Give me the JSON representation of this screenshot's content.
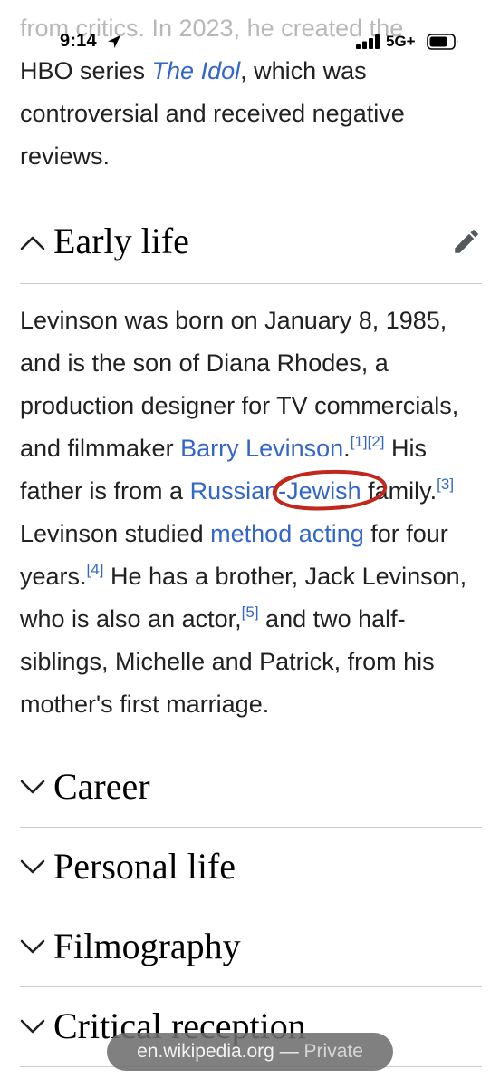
{
  "status_bar": {
    "time": "9:14",
    "network": "5G+"
  },
  "article": {
    "intro": {
      "line1": "from critics. In 2023, he created the",
      "line2_before": "HBO series ",
      "line2_link": "The Idol",
      "line2_after": ", which was",
      "line3": "controversial and received negative",
      "line4": "reviews."
    },
    "early_life": {
      "heading": "Early life",
      "p1": "Levinson was born on January 8, 1985, and is the son of Diana Rhodes, a production designer for TV commercials, and filmmaker ",
      "link_barry": "Barry Levinson",
      "p2": ".",
      "ref1": "[1]",
      "ref2": "[2]",
      "p3": " His father is from a ",
      "link_russian_jewish": "Russian-Jewish",
      "p4": " family.",
      "ref3": "[3]",
      "p5": " Levinson studied ",
      "link_method_acting": "method acting",
      "p6": " for four years.",
      "ref4": "[4]",
      "p7": " He has a brother, Jack Levinson, who is also an actor,",
      "ref5": "[5]",
      "p8": " and two half-siblings, Michelle and Patrick, from his mother's first marriage."
    },
    "sections": [
      {
        "label": "Career"
      },
      {
        "label": "Personal life"
      },
      {
        "label": "Filmography"
      },
      {
        "label": "Critical reception"
      }
    ]
  },
  "url_bar": {
    "domain": "en.wikipedia.org",
    "separator": " — ",
    "mode": "Private"
  },
  "colors": {
    "link": "#3366cc",
    "text": "#202122",
    "annotation": "#c0281e"
  }
}
